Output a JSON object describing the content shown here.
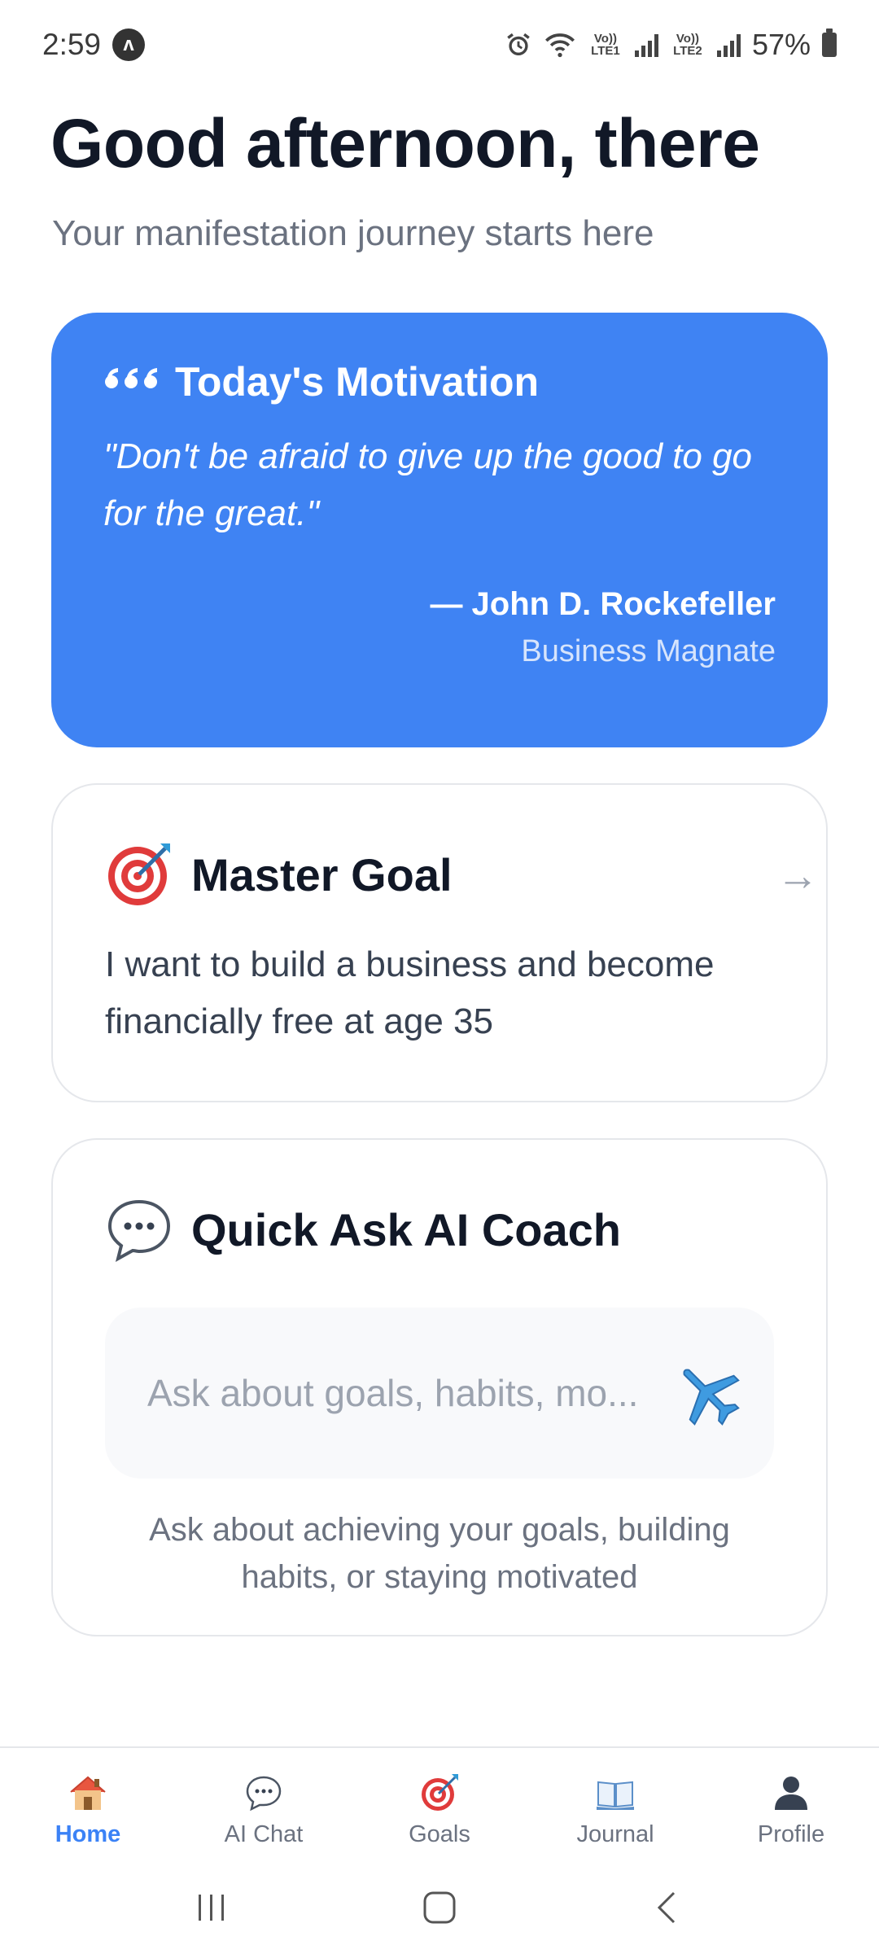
{
  "status_bar": {
    "time": "2:59",
    "nav_badge": "ʌ",
    "battery": "57%",
    "network_1": "Vo)) LTE1",
    "network_2": "Vo)) LTE2"
  },
  "header": {
    "greeting": "Good afternoon, there",
    "subtitle": "Your manifestation journey starts here"
  },
  "motivation": {
    "title": "Today's Motivation",
    "quote": "\"Don't be afraid to give up the good to go for the great.\"",
    "author": "— John D. Rockefeller",
    "role": "Business Magnate",
    "color": "#3f83f3"
  },
  "master_goal": {
    "title": "Master Goal",
    "text": "I want to build a business and become financially free at age 35",
    "icon": "target-icon"
  },
  "coach": {
    "title": "Quick Ask AI Coach",
    "placeholder": "Ask about goals, habits, mo...",
    "hint": "Ask about achieving your goals, building habits, or staying motivated",
    "icon": "speech-bubble-icon",
    "send_icon": "airplane-icon"
  },
  "bottom_nav": {
    "items": [
      {
        "label": "Home",
        "icon": "house-icon",
        "active": true
      },
      {
        "label": "AI Chat",
        "icon": "chat-icon",
        "active": false
      },
      {
        "label": "Goals",
        "icon": "target-icon",
        "active": false
      },
      {
        "label": "Journal",
        "icon": "book-icon",
        "active": false
      },
      {
        "label": "Profile",
        "icon": "person-icon",
        "active": false
      }
    ],
    "active_color": "#3b82f6"
  }
}
